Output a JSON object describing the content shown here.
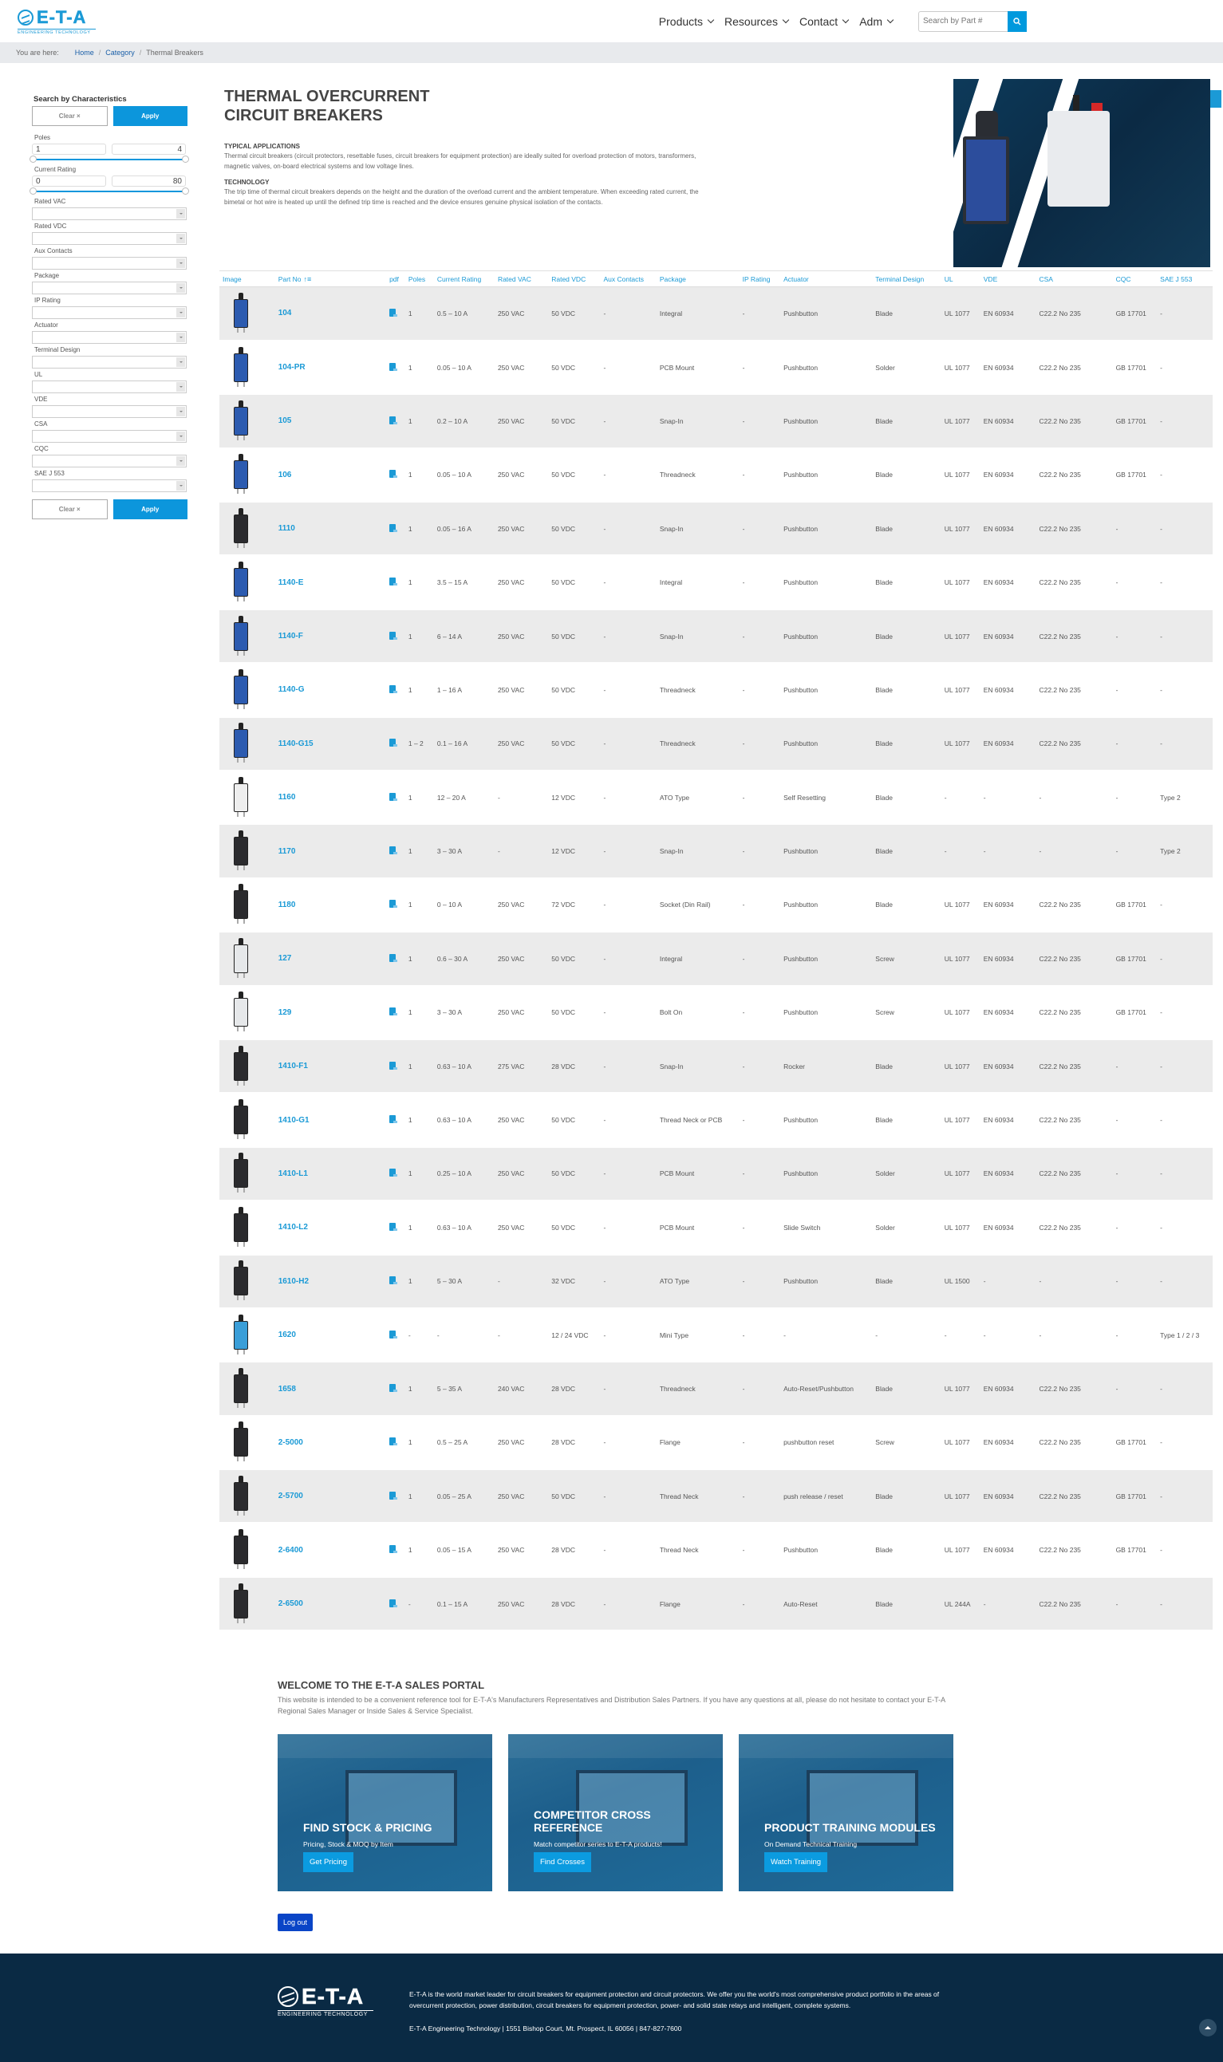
{
  "header": {
    "logo_text": "E-T-A",
    "logo_sub": "ENGINEERING TECHNOLOGY",
    "nav": [
      {
        "label": "Products"
      },
      {
        "label": "Resources"
      },
      {
        "label": "Contact"
      },
      {
        "label": "Adm"
      }
    ],
    "search_placeholder": "Search by Part #"
  },
  "breadcrumb": {
    "prefix": "You are here:",
    "items": [
      "Home",
      "Category",
      "Thermal Breakers"
    ]
  },
  "sidebar": {
    "title": "Search by Characteristics",
    "clear_label": "Clear ×",
    "apply_label": "Apply",
    "poles": {
      "label": "Poles",
      "min": "1",
      "max": "4"
    },
    "current": {
      "label": "Current Rating",
      "min": "0",
      "max": "80"
    },
    "filters": [
      "Rated VAC",
      "Rated VDC",
      "Aux Contacts",
      "Package",
      "IP Rating",
      "Actuator",
      "Terminal Design",
      "UL",
      "VDE",
      "CSA",
      "CQC",
      "SAE J 553"
    ]
  },
  "hero": {
    "title_line1": "THERMAL OVERCURRENT",
    "title_line2": "CIRCUIT BREAKERS",
    "apps_heading": "TYPICAL APPLICATIONS",
    "apps_text": "Thermal circuit breakers (circuit protectors, resettable fuses, circuit breakers for equipment protection) are ideally suited for overload protection of motors, transformers, magnetic valves, on-board electrical systems and low voltage lines.",
    "tech_heading": "TECHNOLOGY",
    "tech_text": "The trip time of thermal circuit breakers depends on the height and the duration of the overload current and the ambient temperature. When exceeding rated current, the bimetal or hot wire is heated up until the defined trip time is reached and the device ensures genuine physical isolation of the contacts."
  },
  "table": {
    "columns": [
      "Image",
      "Part No",
      "pdf",
      "Poles",
      "Current Rating",
      "Rated VAC",
      "Rated VDC",
      "Aux Contacts",
      "Package",
      "IP Rating",
      "Actuator",
      "Terminal Design",
      "UL",
      "VDE",
      "CSA",
      "CQC",
      "SAE J 553"
    ],
    "rows": [
      {
        "part": "104",
        "poles": "1",
        "current": "0.5 – 10 A",
        "vac": "250 VAC",
        "vdc": "50 VDC",
        "aux": "-",
        "package": "Integral",
        "ip": "-",
        "actuator": "Pushbutton",
        "terminal": "Blade",
        "ul": "UL 1077",
        "vde": "EN 60934",
        "csa": "C22.2 No 235",
        "cqc": "GB 17701",
        "sae": "-",
        "img_color": "#2c5bb0"
      },
      {
        "part": "104-PR",
        "poles": "1",
        "current": "0.05 – 10 A",
        "vac": "250 VAC",
        "vdc": "50 VDC",
        "aux": "-",
        "package": "PCB Mount",
        "ip": "-",
        "actuator": "Pushbutton",
        "terminal": "Solder",
        "ul": "UL 1077",
        "vde": "EN 60934",
        "csa": "C22.2 No 235",
        "cqc": "GB 17701",
        "sae": "-",
        "img_color": "#2c5bb0"
      },
      {
        "part": "105",
        "poles": "1",
        "current": "0.2 – 10 A",
        "vac": "250 VAC",
        "vdc": "50 VDC",
        "aux": "-",
        "package": "Snap-In",
        "ip": "-",
        "actuator": "Pushbutton",
        "terminal": "Blade",
        "ul": "UL 1077",
        "vde": "EN 60934",
        "csa": "C22.2 No 235",
        "cqc": "GB 17701",
        "sae": "-",
        "img_color": "#2c5bb0"
      },
      {
        "part": "106",
        "poles": "1",
        "current": "0.05 – 10 A",
        "vac": "250 VAC",
        "vdc": "50 VDC",
        "aux": "-",
        "package": "Threadneck",
        "ip": "-",
        "actuator": "Pushbutton",
        "terminal": "Blade",
        "ul": "UL 1077",
        "vde": "EN 60934",
        "csa": "C22.2 No 235",
        "cqc": "GB 17701",
        "sae": "-",
        "img_color": "#2c5bb0"
      },
      {
        "part": "1110",
        "poles": "1",
        "current": "0.05 – 16 A",
        "vac": "250 VAC",
        "vdc": "50 VDC",
        "aux": "-",
        "package": "Snap-In",
        "ip": "-",
        "actuator": "Pushbutton",
        "terminal": "Blade",
        "ul": "UL 1077",
        "vde": "EN 60934",
        "csa": "C22.2 No 235",
        "cqc": "-",
        "sae": "-",
        "img_color": "#2b2b2e"
      },
      {
        "part": "1140-E",
        "poles": "1",
        "current": "3.5 – 15 A",
        "vac": "250 VAC",
        "vdc": "50 VDC",
        "aux": "-",
        "package": "Integral",
        "ip": "-",
        "actuator": "Pushbutton",
        "terminal": "Blade",
        "ul": "UL 1077",
        "vde": "EN 60934",
        "csa": "C22.2 No 235",
        "cqc": "-",
        "sae": "-",
        "img_color": "#2c5bb0"
      },
      {
        "part": "1140-F",
        "poles": "1",
        "current": "6 – 14 A",
        "vac": "250 VAC",
        "vdc": "50 VDC",
        "aux": "-",
        "package": "Snap-In",
        "ip": "-",
        "actuator": "Pushbutton",
        "terminal": "Blade",
        "ul": "UL 1077",
        "vde": "EN 60934",
        "csa": "C22.2 No 235",
        "cqc": "-",
        "sae": "-",
        "img_color": "#2c5bb0"
      },
      {
        "part": "1140-G",
        "poles": "1",
        "current": "1 – 16 A",
        "vac": "250 VAC",
        "vdc": "50 VDC",
        "aux": "-",
        "package": "Threadneck",
        "ip": "-",
        "actuator": "Pushbutton",
        "terminal": "Blade",
        "ul": "UL 1077",
        "vde": "EN 60934",
        "csa": "C22.2 No 235",
        "cqc": "-",
        "sae": "-",
        "img_color": "#2c5bb0"
      },
      {
        "part": "1140-G15",
        "poles": "1 – 2",
        "current": "0.1 – 16 A",
        "vac": "250 VAC",
        "vdc": "50 VDC",
        "aux": "-",
        "package": "Threadneck",
        "ip": "-",
        "actuator": "Pushbutton",
        "terminal": "Blade",
        "ul": "UL 1077",
        "vde": "EN 60934",
        "csa": "C22.2 No 235",
        "cqc": "-",
        "sae": "-",
        "img_color": "#2c5bb0"
      },
      {
        "part": "1160",
        "poles": "1",
        "current": "12 – 20 A",
        "vac": "-",
        "vdc": "12 VDC",
        "aux": "-",
        "package": "ATO Type",
        "ip": "-",
        "actuator": "Self Resetting",
        "terminal": "Blade",
        "ul": "-",
        "vde": "-",
        "csa": "-",
        "cqc": "-",
        "sae": "Type 2",
        "img_color": "#eeeeee"
      },
      {
        "part": "1170",
        "poles": "1",
        "current": "3 – 30 A",
        "vac": "-",
        "vdc": "12 VDC",
        "aux": "-",
        "package": "Snap-In",
        "ip": "-",
        "actuator": "Pushbutton",
        "terminal": "Blade",
        "ul": "-",
        "vde": "-",
        "csa": "-",
        "cqc": "-",
        "sae": "Type 2",
        "img_color": "#2b2b2e"
      },
      {
        "part": "1180",
        "poles": "1",
        "current": "0 – 10 A",
        "vac": "250 VAC",
        "vdc": "72 VDC",
        "aux": "-",
        "package": "Socket (Din Rail)",
        "ip": "-",
        "actuator": "Pushbutton",
        "terminal": "Blade",
        "ul": "UL 1077",
        "vde": "EN 60934",
        "csa": "C22.2 No 235",
        "cqc": "GB 17701",
        "sae": "-",
        "img_color": "#2b2b2e"
      },
      {
        "part": "127",
        "poles": "1",
        "current": "0.6 – 30 A",
        "vac": "250 VAC",
        "vdc": "50 VDC",
        "aux": "-",
        "package": "Integral",
        "ip": "-",
        "actuator": "Pushbutton",
        "terminal": "Screw",
        "ul": "UL 1077",
        "vde": "EN 60934",
        "csa": "C22.2 No 235",
        "cqc": "GB 17701",
        "sae": "-",
        "img_color": "#e6e8ea"
      },
      {
        "part": "129",
        "poles": "1",
        "current": "3 – 30 A",
        "vac": "250 VAC",
        "vdc": "50 VDC",
        "aux": "-",
        "package": "Bolt On",
        "ip": "-",
        "actuator": "Pushbutton",
        "terminal": "Screw",
        "ul": "UL 1077",
        "vde": "EN 60934",
        "csa": "C22.2 No 235",
        "cqc": "GB 17701",
        "sae": "-",
        "img_color": "#e6e8ea"
      },
      {
        "part": "1410-F1",
        "poles": "1",
        "current": "0.63 – 10 A",
        "vac": "275 VAC",
        "vdc": "28 VDC",
        "aux": "-",
        "package": "Snap-In",
        "ip": "-",
        "actuator": "Rocker",
        "terminal": "Blade",
        "ul": "UL 1077",
        "vde": "EN 60934",
        "csa": "C22.2 No 235",
        "cqc": "-",
        "sae": "-",
        "img_color": "#2b2b2e"
      },
      {
        "part": "1410-G1",
        "poles": "1",
        "current": "0.63 – 10 A",
        "vac": "250 VAC",
        "vdc": "50 VDC",
        "aux": "-",
        "package": "Thread Neck or PCB",
        "ip": "-",
        "actuator": "Pushbutton",
        "terminal": "Blade",
        "ul": "UL 1077",
        "vde": "EN 60934",
        "csa": "C22.2 No 235",
        "cqc": "-",
        "sae": "-",
        "img_color": "#2b2b2e"
      },
      {
        "part": "1410-L1",
        "poles": "1",
        "current": "0.25 – 10 A",
        "vac": "250 VAC",
        "vdc": "50 VDC",
        "aux": "-",
        "package": "PCB Mount",
        "ip": "-",
        "actuator": "Pushbutton",
        "terminal": "Solder",
        "ul": "UL 1077",
        "vde": "EN 60934",
        "csa": "C22.2 No 235",
        "cqc": "-",
        "sae": "-",
        "img_color": "#2b2b2e"
      },
      {
        "part": "1410-L2",
        "poles": "1",
        "current": "0.63 – 10 A",
        "vac": "250 VAC",
        "vdc": "50 VDC",
        "aux": "-",
        "package": "PCB Mount",
        "ip": "-",
        "actuator": "Slide Switch",
        "terminal": "Solder",
        "ul": "UL 1077",
        "vde": "EN 60934",
        "csa": "C22.2 No 235",
        "cqc": "-",
        "sae": "-",
        "img_color": "#2b2b2e"
      },
      {
        "part": "1610-H2",
        "poles": "1",
        "current": "5 – 30 A",
        "vac": "-",
        "vdc": "32 VDC",
        "aux": "-",
        "package": "ATO Type",
        "ip": "-",
        "actuator": "Pushbutton",
        "terminal": "Blade",
        "ul": "UL 1500",
        "vde": "-",
        "csa": "-",
        "cqc": "-",
        "sae": "-",
        "img_color": "#2b2b2e"
      },
      {
        "part": "1620",
        "poles": "-",
        "current": "-",
        "vac": "-",
        "vdc": "12 / 24 VDC",
        "aux": "-",
        "package": "Mini Type",
        "ip": "-",
        "actuator": "-",
        "terminal": "-",
        "ul": "-",
        "vde": "-",
        "csa": "-",
        "cqc": "-",
        "sae": "Type 1 / 2 / 3",
        "img_color": "#3a9ed8"
      },
      {
        "part": "1658",
        "poles": "1",
        "current": "5 – 35 A",
        "vac": "240 VAC",
        "vdc": "28 VDC",
        "aux": "-",
        "package": "Threadneck",
        "ip": "-",
        "actuator": "Auto-Reset/Pushbutton",
        "terminal": "Blade",
        "ul": "UL 1077",
        "vde": "EN 60934",
        "csa": "C22.2 No 235",
        "cqc": "-",
        "sae": "-",
        "img_color": "#2b2b2e"
      },
      {
        "part": "2-5000",
        "poles": "1",
        "current": "0.5 – 25 A",
        "vac": "250 VAC",
        "vdc": "28 VDC",
        "aux": "-",
        "package": "Flange",
        "ip": "-",
        "actuator": "pushbutton reset",
        "terminal": "Screw",
        "ul": "UL 1077",
        "vde": "EN 60934",
        "csa": "C22.2 No 235",
        "cqc": "GB 17701",
        "sae": "-",
        "img_color": "#2b2b2e"
      },
      {
        "part": "2-5700",
        "poles": "1",
        "current": "0.05 – 25 A",
        "vac": "250 VAC",
        "vdc": "50 VDC",
        "aux": "-",
        "package": "Thread Neck",
        "ip": "-",
        "actuator": "push release / reset",
        "terminal": "Blade",
        "ul": "UL 1077",
        "vde": "EN 60934",
        "csa": "C22.2 No 235",
        "cqc": "GB 17701",
        "sae": "-",
        "img_color": "#2b2b2e"
      },
      {
        "part": "2-6400",
        "poles": "1",
        "current": "0.05 – 15 A",
        "vac": "250 VAC",
        "vdc": "28 VDC",
        "aux": "-",
        "package": "Thread Neck",
        "ip": "-",
        "actuator": "Pushbutton",
        "terminal": "Blade",
        "ul": "UL 1077",
        "vde": "EN 60934",
        "csa": "C22.2 No 235",
        "cqc": "GB 17701",
        "sae": "-",
        "img_color": "#2b2b2e"
      },
      {
        "part": "2-6500",
        "poles": "-",
        "current": "0.1 – 15 A",
        "vac": "250 VAC",
        "vdc": "28 VDC",
        "aux": "-",
        "package": "Flange",
        "ip": "-",
        "actuator": "Auto-Reset",
        "terminal": "Blade",
        "ul": "UL 244A",
        "vde": "-",
        "csa": "C22.2 No 235",
        "cqc": "-",
        "sae": "-",
        "img_color": "#2b2b2e"
      }
    ]
  },
  "welcome": {
    "title": "WELCOME TO THE E-T-A SALES PORTAL",
    "text": "This website is intended to be a convenient reference tool for E-T-A's Manufacturers Representatives and Distribution Sales Partners. If you have any questions at all, please do not hesitate to contact your E-T-A Regional Sales Manager or Inside Sales & Service Specialist.",
    "cards": [
      {
        "title": "FIND STOCK & PRICING",
        "sub": "Pricing, Stock & MOQ by Item",
        "button": "Get Pricing"
      },
      {
        "title": "COMPETITOR CROSS REFERENCE",
        "sub": "Match competitor series to E-T-A products!",
        "button": "Find Crosses"
      },
      {
        "title": "PRODUCT TRAINING MODULES",
        "sub": "On Demand Technical Training",
        "button": "Watch Training"
      }
    ],
    "logout_label": "Log out"
  },
  "footer": {
    "logo_text": "E-T-A",
    "logo_sub": "ENGINEERING TECHNOLOGY",
    "text": "E-T-A is the world market leader for circuit breakers for equipment protection and circuit protectors. We offer you the world's most comprehensive product portfolio in the areas of overcurrent protection, power distribution, circuit breakers for equipment protection, power- and solid state relays and intelligent, complete systems.",
    "address": "E-T-A Engineering Technology | 1551 Bishop Court, Mt. Prospect, IL 60056 | 847-827-7600"
  },
  "colors": {
    "accent": "#0c96dc",
    "link": "#1b9ad6",
    "footer_bg": "#0a2a44",
    "logout": "#0a45c7"
  }
}
